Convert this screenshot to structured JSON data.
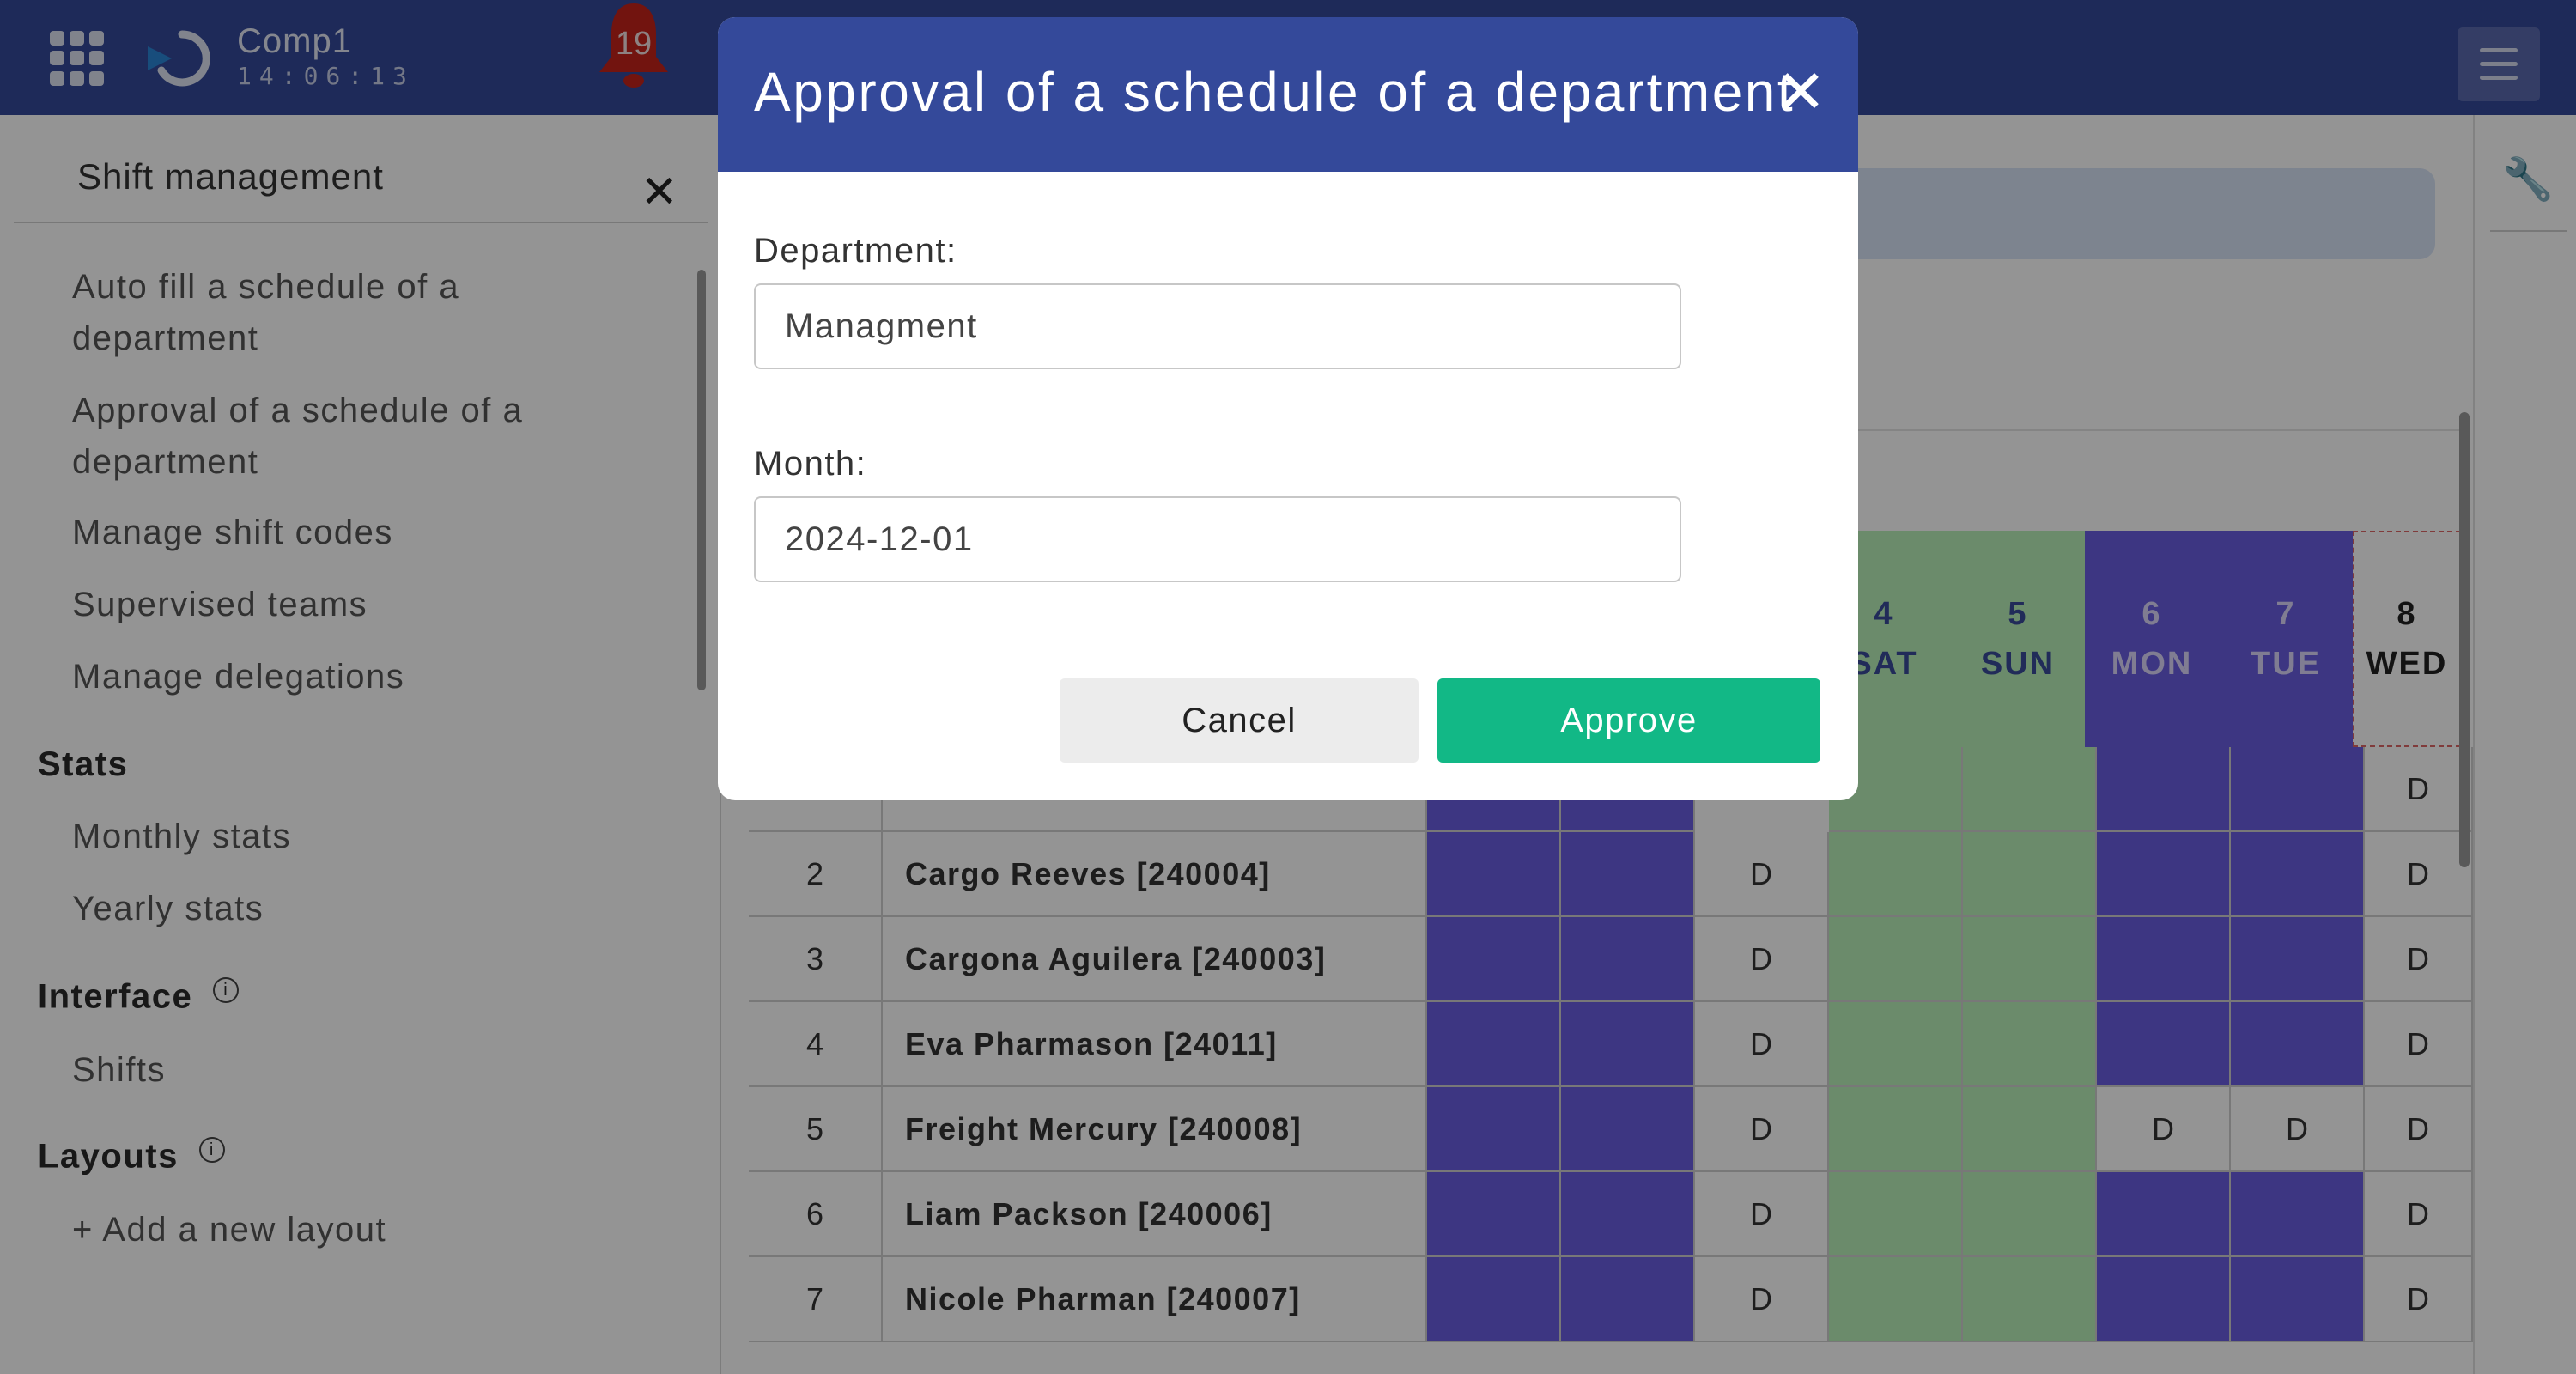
{
  "app": {
    "name": "Comp1",
    "clock": "14:06:13",
    "notification_count": "19"
  },
  "sidebar": {
    "title": "Shift management",
    "items": [
      "Auto fill a schedule of a department",
      "Approval of a schedule of a department",
      "Manage shift codes",
      "Supervised teams",
      "Manage delegations"
    ],
    "sections": [
      {
        "title": "Stats",
        "items": [
          "Monthly stats",
          "Yearly stats"
        ]
      },
      {
        "title": "Interface",
        "items": [
          "Shifts"
        ]
      },
      {
        "title": "Layouts",
        "items": [
          "+ Add a new layout"
        ]
      }
    ]
  },
  "schedule": {
    "headers": [
      {
        "day": "4",
        "weekday": "SAT",
        "type": "weekend"
      },
      {
        "day": "5",
        "weekday": "SUN",
        "type": "weekend"
      },
      {
        "day": "6",
        "weekday": "MON",
        "type": "holiday"
      },
      {
        "day": "7",
        "weekday": "TUE",
        "type": "holiday"
      },
      {
        "day": "8",
        "weekday": "WED",
        "type": "today"
      }
    ],
    "shift_code": "D",
    "rows": [
      {
        "num": "2",
        "name": "Cargo Reeves [240004]"
      },
      {
        "num": "3",
        "name": "Cargona Aguilera [240003]"
      },
      {
        "num": "4",
        "name": "Eva Pharmason [24011]"
      },
      {
        "num": "5",
        "name": "Freight Mercury [240008]"
      },
      {
        "num": "6",
        "name": "Liam Packson [240006]"
      },
      {
        "num": "7",
        "name": "Nicole Pharman [240007]"
      }
    ]
  },
  "modal": {
    "title": "Approval of a schedule of a department",
    "department_label": "Department:",
    "department_value": "Managment",
    "month_label": "Month:",
    "month_value": "2024-12-01",
    "cancel_label": "Cancel",
    "approve_label": "Approve"
  },
  "colors": {
    "topbar": "#34499a",
    "approve": "#12b886",
    "holiday": "#6a5de0",
    "weekend": "#b8f0b8",
    "alert": "#e63322"
  }
}
